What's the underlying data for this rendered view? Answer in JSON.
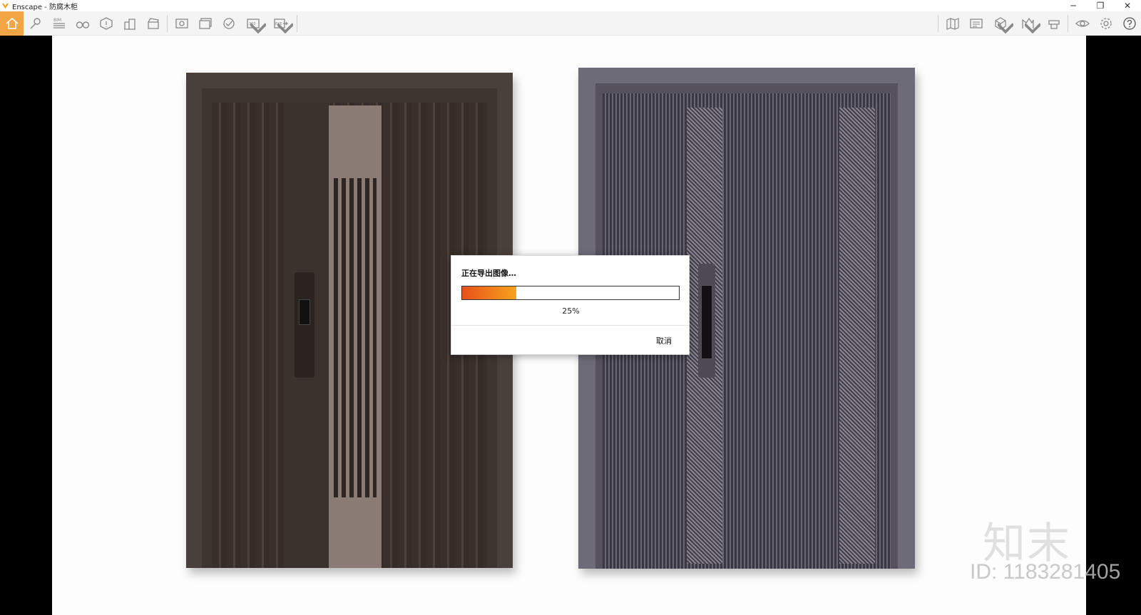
{
  "window": {
    "title": "Enscape - 防腐木柜",
    "minimize": "─",
    "restore": "❐",
    "close": "✕"
  },
  "toolbar": {
    "left_icons": [
      "home-icon",
      "location-pin-icon",
      "bim-icon",
      "binoculars-icon",
      "warning-cube-icon",
      "buildings-icon",
      "clapper-icon",
      "screenshot-icon",
      "batch-render-icon",
      "panorama-upload-icon",
      "render-360-icon",
      "export-exe-icon"
    ],
    "right_icons": [
      "map-icon",
      "view-management-icon",
      "cube-view-icon",
      "assets-icon",
      "material-editor-icon",
      "visual-settings-icon",
      "settings-icon",
      "help-icon"
    ],
    "accent_color": "#f2a545"
  },
  "dialog": {
    "title": "正在导出图像…",
    "progress_percent": 25,
    "progress_label": "25%",
    "cancel_label": "取消"
  },
  "watermark": {
    "logo_text": "知末",
    "id_text": "ID: 1183281405"
  }
}
